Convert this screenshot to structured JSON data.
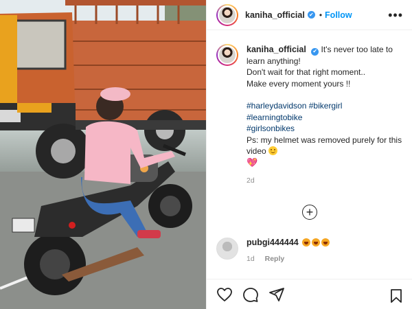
{
  "post": {
    "username": "kaniha_official",
    "verified_mark": "✔",
    "separator": "•",
    "follow_label": "Follow",
    "more_icon": "more-horizontal-icon",
    "more_label": "•••"
  },
  "caption": {
    "username": "kaniha_official",
    "line1": "It's never too late to learn anything!",
    "line2": "Don't wait for that right moment..",
    "line3": "Make every moment yours !!",
    "hashtags": [
      "#harleydavidson",
      "#bikergirl",
      "#learningtobike",
      "#girlsonbikes"
    ],
    "line4": "Ps: my helmet was removed purely for this video",
    "emoji_heart": "💖",
    "time": "2d"
  },
  "load_more_label": "+",
  "comment": {
    "username": "pubgi444444",
    "emoji_count": 3,
    "time": "1d",
    "reply_label": "Reply"
  },
  "actions": {
    "icons": [
      "heart-icon",
      "comment-icon",
      "share-icon",
      "bookmark-icon"
    ]
  },
  "colors": {
    "link_blue": "#0095f6",
    "hashtag": "#00376b",
    "muted": "#8e8e8e",
    "truck_orange": "#c8663c",
    "cab_yellow": "#e9a21e"
  }
}
